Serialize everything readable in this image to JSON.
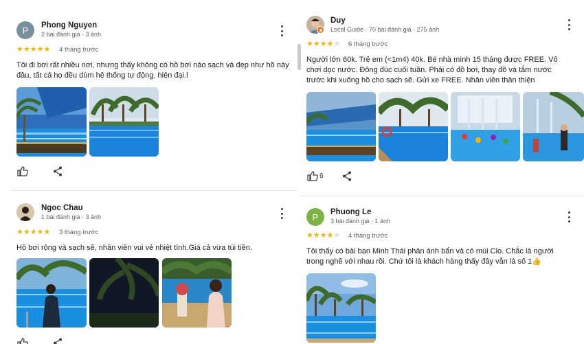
{
  "reviews": [
    {
      "avatar_letter": "P",
      "name": "Phong Nguyen",
      "meta": "2 bài đánh giá · 3 ảnh",
      "rating": 5,
      "time": "4 tháng trước",
      "text": "Tôi đi bơi rất nhiều nơi, nhưng thấy không có hồ bơi nào sạch và đẹp như hồ này đâu, tất cả họ đều dùm hệ thống tự động, hiện đại.l",
      "like_count": ""
    },
    {
      "avatar_letter": "",
      "name": "Ngoc Chau",
      "meta": "1 bài đánh giá · 3 ảnh",
      "rating": 5,
      "time": "3 tháng trước",
      "text": "Hồ bơi rộng và sạch sẽ, nhân viên vui vẻ nhiệt tình.Giá cả vừa túi tiền.",
      "like_count": ""
    },
    {
      "avatar_letter": "",
      "name": "Duy",
      "meta": "Local Guide · 70 bài đánh giá · 275 ảnh",
      "rating": 4,
      "time": "6 tháng trước",
      "text": "Người lớn 60k. Trẻ em (<1m4) 40k. Bé nhà mình 15 tháng được FREE. Vô chơi dọc nước. Đông đúc cuối tuần. Phải có đồ bơi, thay đồ và tắm nước trước khi xuống hồ cho sạch sẽ. Gửi xe FREE. Nhân viên thân thiện",
      "like_count": "6"
    },
    {
      "avatar_letter": "P",
      "name": "Phuong Le",
      "meta": "3 bài đánh giá · 1 ảnh",
      "rating": 4,
      "time": "4 tháng trước",
      "text": "Tôi thấy có bài bạn Minh Thái phản ánh bẩn và có mùi Clo. Chắc là người trong nghề với nhau rồi. Chứ tôi là khách hàng thấy đây vẫn là số 1👍",
      "like_count": ""
    }
  ],
  "colors": {
    "star": "#f5b400",
    "star_empty": "#dadce0",
    "avatar_grey": "#78909c",
    "avatar_green": "#7cb342",
    "water": "#1f8ce0",
    "sky": "#6fa8dc",
    "palm": "#3f6b2a"
  },
  "icons": [
    "thumbs-up-icon",
    "share-icon",
    "more-vert-icon",
    "local-guide-badge-icon"
  ]
}
